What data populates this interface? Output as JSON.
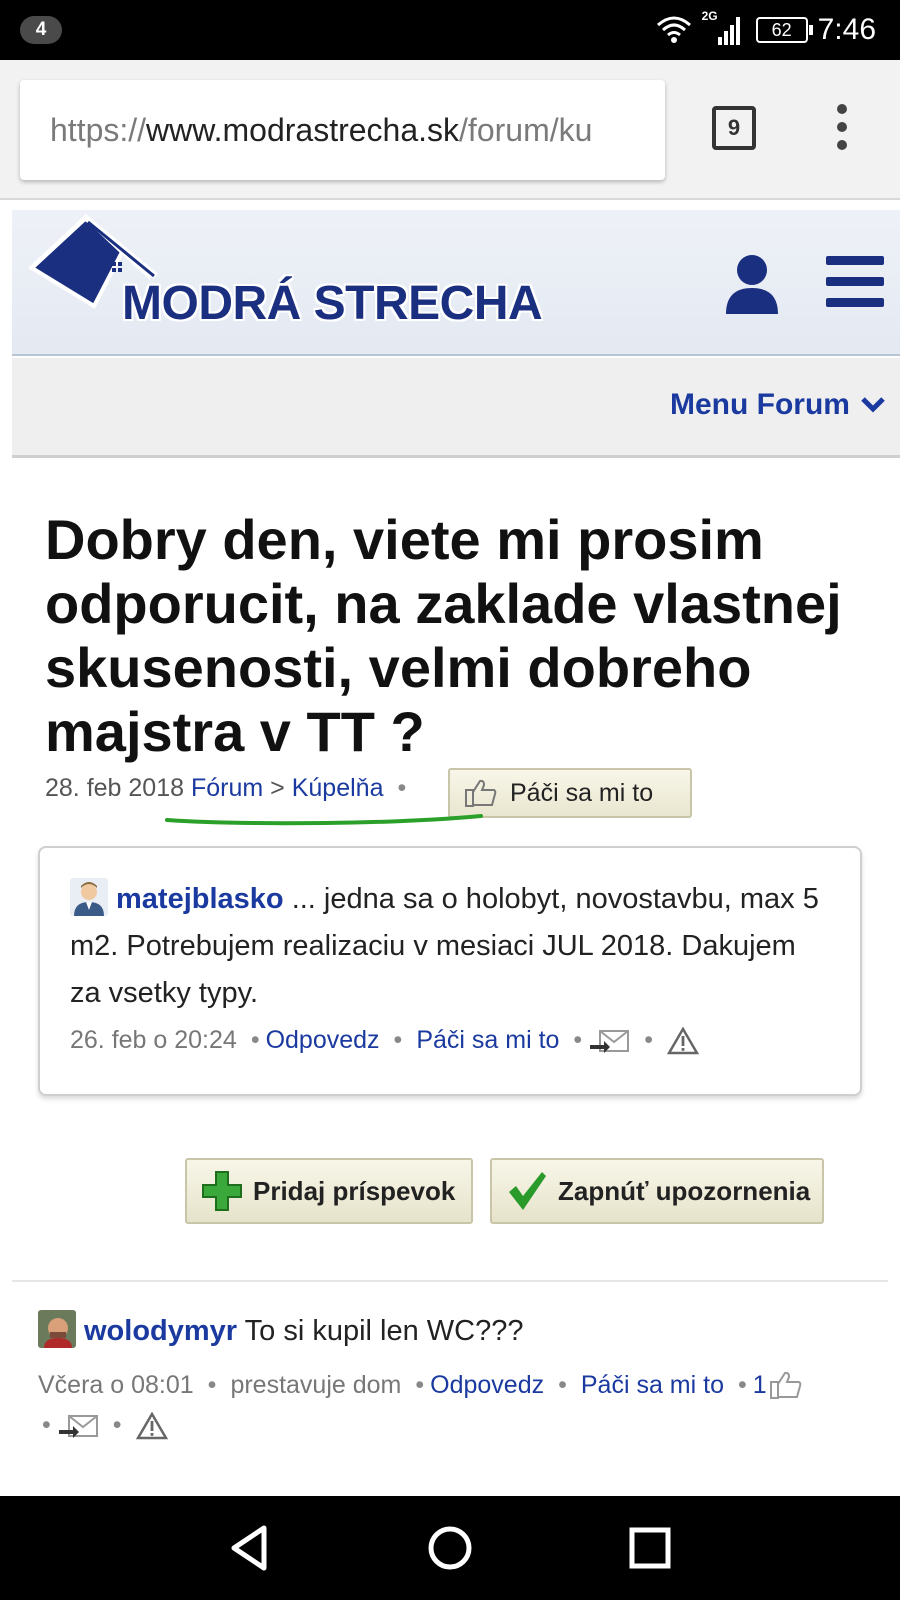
{
  "status_bar": {
    "notification_count": "4",
    "network": "2G",
    "battery": "62",
    "time": "7:46"
  },
  "browser": {
    "url_scheme": "https://",
    "url_host": "www.modrastrecha.sk",
    "url_path": "/forum/ku",
    "tab_count": "9"
  },
  "site": {
    "logo_text": "MODRÁ STRECHA",
    "menu_forum_label": "Menu Forum"
  },
  "thread": {
    "title": "Dobry den, viete mi prosim odporucit, na zaklade vlastnej skusenosti, velmi dobreho majstra v TT ?",
    "date": "28. feb 2018",
    "breadcrumb_forum": "Fórum",
    "breadcrumb_sep": ">",
    "breadcrumb_category": "Kúpelňa",
    "like_label": "Páči sa mi to"
  },
  "post": {
    "author": "matejblasko",
    "text": " ... jedna sa o holobyt, novostavbu, max 5 m2. Potrebujem realizaciu v mesiaci JUL 2018. Dakujem za vsetky typy.",
    "time": "26. feb o 20:24",
    "reply_label": "Odpovedz",
    "like_label": "Páči sa mi to"
  },
  "actions": {
    "add_post_label": "Pridaj príspevok",
    "notify_label": "Zapnúť upozornenia"
  },
  "comment": {
    "author": "wolodymyr",
    "text": " To si kupil len WC???",
    "time": "Včera o 08:01",
    "context": "prestavuje dom",
    "reply_label": "Odpovedz",
    "like_label": "Páči sa mi to",
    "like_count": "1"
  },
  "separator": "•"
}
